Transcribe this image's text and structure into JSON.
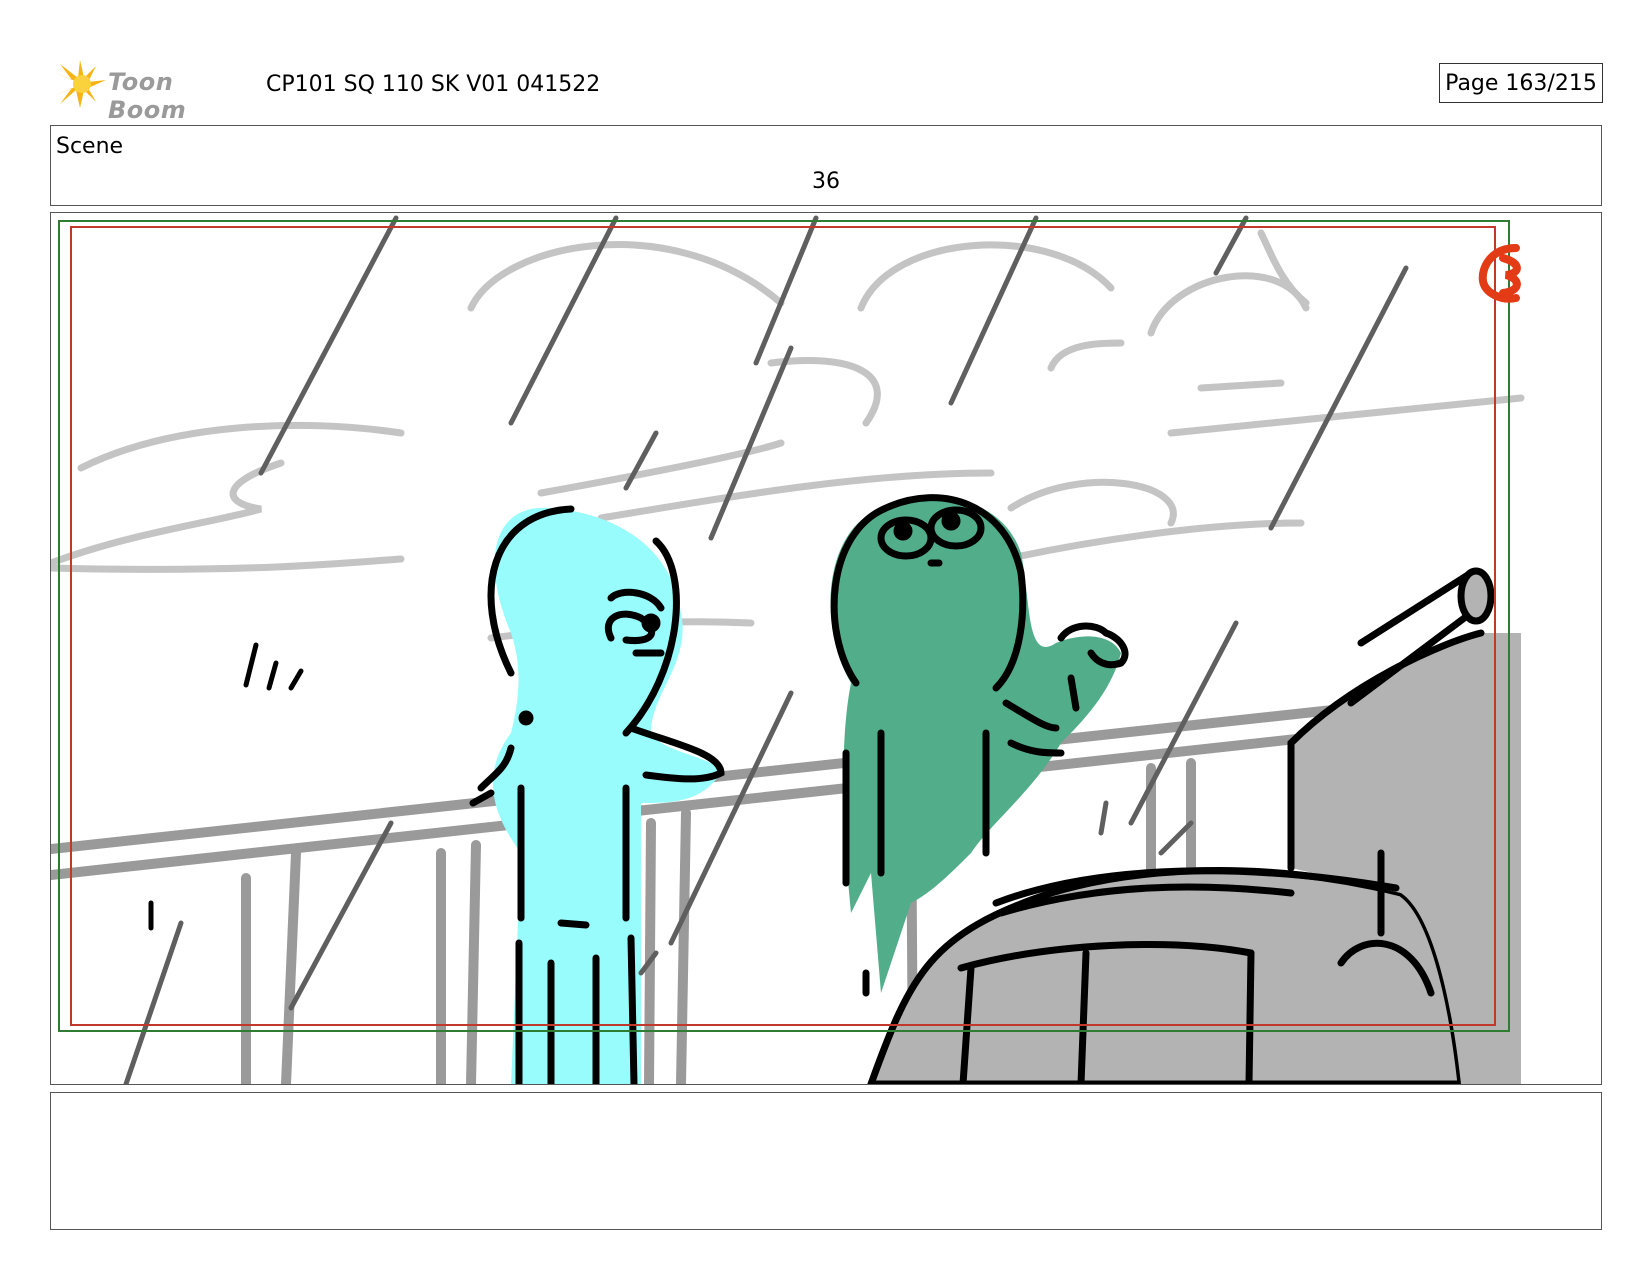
{
  "header": {
    "logo_text": "Toon Boom",
    "title": "CP101 SQ 110 SK V01 041522",
    "page": "Page 163/215"
  },
  "scene": {
    "label": "Scene",
    "number": "36"
  },
  "panel": {
    "description_text": "",
    "colors": {
      "blue_character": "#98fcfc",
      "green_character": "#52ae8a",
      "vehicle": "#b3b3b3",
      "rain": "#5f5f5f",
      "background_lines": "#c4c4c4",
      "safe_frame_red": "#c0392b",
      "safe_frame_green": "#2e7d32",
      "corner_mark": "#e23b16"
    }
  },
  "caption": {
    "text": ""
  }
}
